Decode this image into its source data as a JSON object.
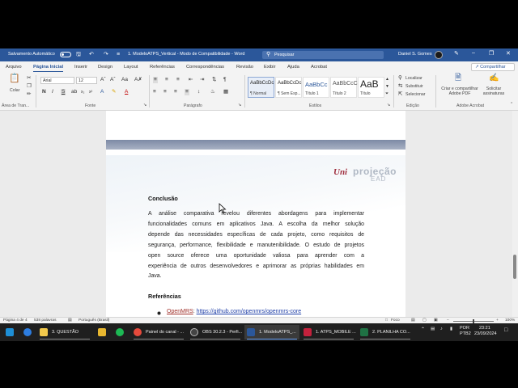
{
  "titlebar": {
    "autosave_label": "Salvamento Automático",
    "document_title": "1. ModeloATPS_Vertical - Modo de Compatibilidade - Word",
    "search_placeholder": "Pesquisar",
    "user_name": "Daniel S. Gomes"
  },
  "tabs": [
    "Arquivo",
    "Página Inicial",
    "Inserir",
    "Design",
    "Layout",
    "Referências",
    "Correspondências",
    "Revisão",
    "Exibir",
    "Ajuda",
    "Acrobat"
  ],
  "share_label": "Compartilhar",
  "ribbon": {
    "clipboard": {
      "paste_label": "Colar",
      "group_label": "Área de Tran..."
    },
    "font": {
      "name": "Arial",
      "size": "12",
      "group_label": "Fonte"
    },
    "paragraph": {
      "group_label": "Parágrafo"
    },
    "styles": {
      "items": [
        {
          "preview": "AaBbCcDc",
          "name": "¶ Normal"
        },
        {
          "preview": "AaBbCcDc",
          "name": "¶ Sem Esp..."
        },
        {
          "preview": "AaBbCc",
          "name": "Título 1"
        },
        {
          "preview": "AaBbCcC",
          "name": "Título 2"
        },
        {
          "preview": "AaB",
          "name": "Título"
        }
      ],
      "group_label": "Estilos"
    },
    "editing": {
      "find": "Localizar",
      "replace": "Substituir",
      "select": "Selecionar",
      "group_label": "Edição"
    },
    "acrobat": {
      "create_share": "Criar e compartilhar Adobe PDF",
      "request_signatures": "Solicitar assinaturas",
      "group_label": "Adobe Acrobat"
    }
  },
  "document": {
    "logo": {
      "part1": "Uni",
      "part2": "projeção",
      "part3": "EAD"
    },
    "conclusion_heading": "Conclusão",
    "conclusion_lines": [
      "A análise comparativa revelou diferentes abordagens para implementar",
      "funcionalidades comuns em aplicativos Java. A escolha da melhor solução",
      "depende das necessidades específicas de cada projeto, como requisitos de",
      "segurança, performance, flexibilidade e manutenibilidade. O estudo de projetos",
      "open source oferece uma oportunidade valiosa para aprender com a",
      "experiência de outros desenvolvedores e aprimorar as próprias habilidades em",
      "Java."
    ],
    "references_heading": "Referências",
    "reference_1": {
      "name": "OpenMRS",
      "separator": ": ",
      "url": "https://github.com/openmrs/openmrs-core"
    }
  },
  "statusbar": {
    "page": "Página 4 de 4",
    "words": "538 palavras",
    "language": "Português (Brasil)",
    "focus": "Foco",
    "zoom": "100%"
  },
  "taskbar": {
    "apps": [
      {
        "label": "",
        "color": "#1e8fd6"
      },
      {
        "label": "",
        "color": "#2d7de0"
      },
      {
        "label": "3. QUESTÃO",
        "color": "#f2c94c"
      },
      {
        "label": "",
        "color": "#e8b730"
      },
      {
        "label": "",
        "color": "#1db954"
      },
      {
        "label": "Painel do canal - ...",
        "color": "#e64a3c"
      },
      {
        "label": "OBS 30.2.3 - Perfi...",
        "color": "#444444"
      },
      {
        "label": "1. ModeloATPS_...",
        "color": "#2b579a"
      },
      {
        "label": "1. ATPS_MOBILE ...",
        "color": "#c4213c"
      },
      {
        "label": "2. PLANILHA CO...",
        "color": "#1f7244"
      }
    ],
    "tray": {
      "language": "POR",
      "layout": "PTB2",
      "time": "23:21",
      "date": "23/09/2024"
    }
  }
}
